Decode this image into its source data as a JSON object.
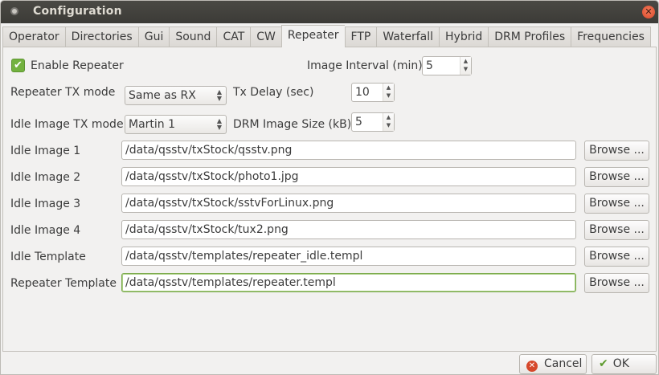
{
  "window": {
    "title": "Configuration"
  },
  "tabs": [
    "Operator",
    "Directories",
    "Gui",
    "Sound",
    "CAT",
    "CW",
    "Repeater",
    "FTP",
    "Waterfall",
    "Hybrid",
    "DRM Profiles",
    "Frequencies"
  ],
  "active_tab": "Repeater",
  "repeater": {
    "enable_label": "Enable Repeater",
    "enable_checked": true,
    "image_interval_label": "Image Interval (min)",
    "image_interval_value": "5",
    "tx_mode_label": "Repeater TX mode",
    "tx_mode_value": "Same as RX",
    "tx_delay_label": "Tx Delay (sec)",
    "tx_delay_value": "10",
    "idle_tx_mode_label": "Idle Image TX mode",
    "idle_tx_mode_value": "Martin 1",
    "drm_size_label": "DRM Image Size (kB)",
    "drm_size_value": "5"
  },
  "paths": [
    {
      "label": "Idle Image 1",
      "value": "/data/qsstv/txStock/qsstv.png",
      "browse": "Browse ..."
    },
    {
      "label": "Idle Image 2",
      "value": "/data/qsstv/txStock/photo1.jpg",
      "browse": "Browse ..."
    },
    {
      "label": "Idle Image 3",
      "value": "/data/qsstv/txStock/sstvForLinux.png",
      "browse": "Browse ..."
    },
    {
      "label": "Idle Image 4",
      "value": "/data/qsstv/txStock/tux2.png",
      "browse": "Browse ..."
    },
    {
      "label": "Idle Template",
      "value": "/data/qsstv/templates/repeater_idle.templ",
      "browse": "Browse ..."
    },
    {
      "label": "Repeater Template",
      "value": "/data/qsstv/templates/repeater.templ",
      "browse": "Browse ..."
    }
  ],
  "buttons": {
    "cancel": "Cancel",
    "ok": "OK"
  },
  "colors": {
    "titlebar": "#3c3b37",
    "check": "#73b23f",
    "focus": "#7aa94b",
    "close": "#d9482b"
  }
}
